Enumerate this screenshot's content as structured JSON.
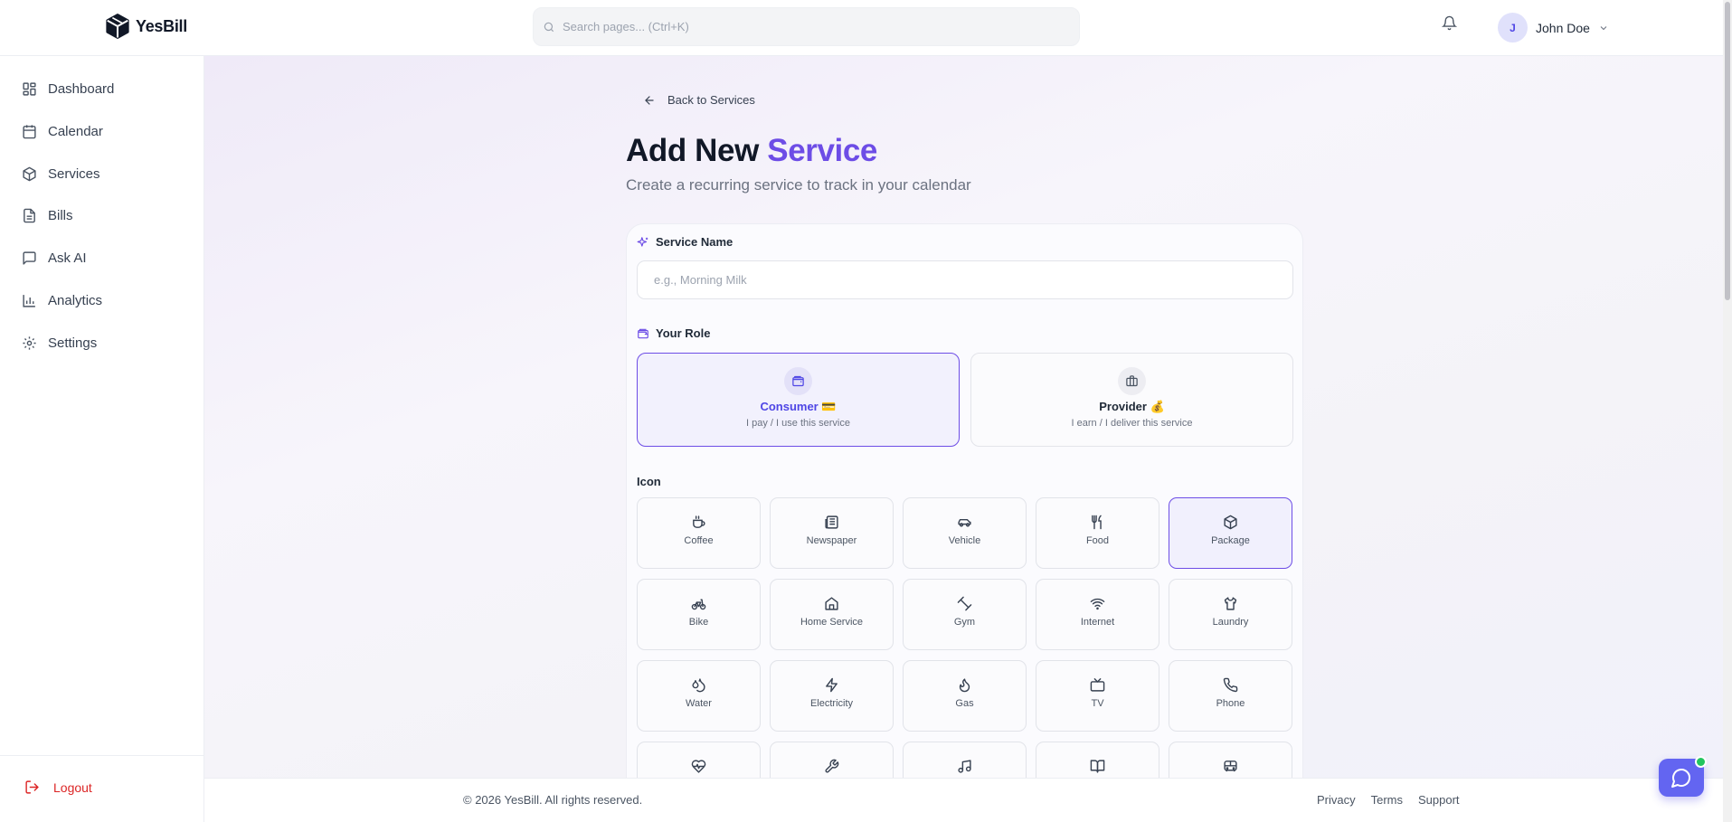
{
  "app": {
    "name": "YesBill"
  },
  "search": {
    "placeholder": "Search pages... (Ctrl+K)"
  },
  "user": {
    "initial": "J",
    "name": "John Doe"
  },
  "sidebar": {
    "items": [
      {
        "label": "Dashboard",
        "icon": "dashboard-icon"
      },
      {
        "label": "Calendar",
        "icon": "calendar-icon"
      },
      {
        "label": "Services",
        "icon": "box-icon"
      },
      {
        "label": "Bills",
        "icon": "file-icon"
      },
      {
        "label": "Ask AI",
        "icon": "chat-icon"
      },
      {
        "label": "Analytics",
        "icon": "bar-chart-icon"
      },
      {
        "label": "Settings",
        "icon": "gear-icon"
      }
    ],
    "logout": "Logout"
  },
  "page": {
    "back_label": "Back to Services",
    "title_main": "Add New ",
    "title_accent": "Service",
    "subtitle": "Create a recurring service to track in your calendar"
  },
  "form": {
    "service_name_label": "Service Name",
    "service_name_placeholder": "e.g., Morning Milk",
    "role_label": "Your Role",
    "roles": [
      {
        "title": "Consumer 💳",
        "subtitle": "I pay / I use this service",
        "selected": true
      },
      {
        "title": "Provider 💰",
        "subtitle": "I earn / I deliver this service",
        "selected": false
      }
    ],
    "icon_label": "Icon",
    "icons": [
      {
        "name": "Coffee",
        "icon": "coffee-icon"
      },
      {
        "name": "Newspaper",
        "icon": "newspaper-icon"
      },
      {
        "name": "Vehicle",
        "icon": "car-icon"
      },
      {
        "name": "Food",
        "icon": "utensils-icon"
      },
      {
        "name": "Package",
        "icon": "package-icon",
        "selected": true
      },
      {
        "name": "Bike",
        "icon": "bike-icon"
      },
      {
        "name": "Home Service",
        "icon": "home-icon"
      },
      {
        "name": "Gym",
        "icon": "dumbbell-icon"
      },
      {
        "name": "Internet",
        "icon": "wifi-icon"
      },
      {
        "name": "Laundry",
        "icon": "shirt-icon"
      },
      {
        "name": "Water",
        "icon": "droplets-icon"
      },
      {
        "name": "Electricity",
        "icon": "zap-icon"
      },
      {
        "name": "Gas",
        "icon": "flame-icon"
      },
      {
        "name": "TV",
        "icon": "tv-icon"
      },
      {
        "name": "Phone",
        "icon": "phone-icon"
      }
    ],
    "partial_icons": [
      "heart-pulse-icon",
      "wrench-icon",
      "music-icon",
      "book-open-icon",
      "bus-icon"
    ]
  },
  "footer": {
    "copyright": "© 2026 YesBill. All rights reserved.",
    "links": [
      "Privacy",
      "Terms",
      "Support"
    ]
  },
  "colors": {
    "accent": "#6d4de6",
    "logout": "#dc2626",
    "chat_button": "#6365f1",
    "online_dot": "#22c55e"
  }
}
